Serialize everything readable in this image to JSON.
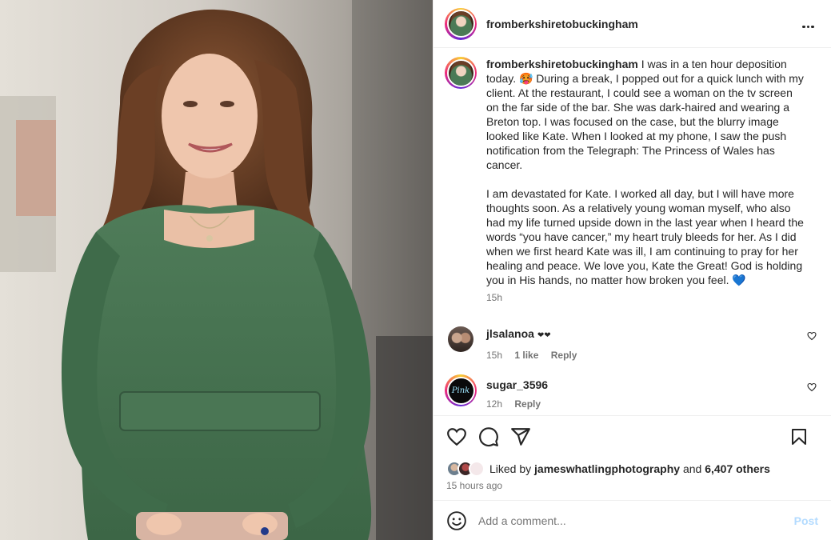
{
  "post": {
    "username": "fromberkshiretobuckingham",
    "caption_para1": "I was in a ten hour deposition today. 🥵 During a break, I popped out for a quick lunch with my client. At the restaurant, I could see a woman on the tv screen on the far side of the bar. She was dark-haired and wearing a Breton top. I was focused on the case, but the blurry image looked like Kate. When I looked at my phone, I saw the push notification from the Telegraph: The Princess of Wales has cancer.",
    "caption_para2": "I am devastated for Kate. I worked all day, but I will have more thoughts soon. As a relatively young woman myself, who also had my life turned upside down in the last year when I heard the words “you have cancer,” my heart truly bleeds for her. As I did when we first heard Kate was ill, I am continuing to pray for her healing and peace. We love you, Kate the Great! God is holding you in His hands, no matter how broken you feel. 💙",
    "caption_time": "15h",
    "more_icon": "more-horizontal-icon"
  },
  "comments": [
    {
      "username": "jlsalanoa",
      "text": "❤❤",
      "time": "15h",
      "likes": "1 like",
      "reply": "Reply"
    },
    {
      "username": "sugar_3596",
      "text": "",
      "time": "12h",
      "reply": "Reply",
      "avatar_text": "Pink"
    }
  ],
  "actions": {
    "icons": [
      "heart-icon",
      "comment-icon",
      "share-icon",
      "bookmark-icon"
    ]
  },
  "likes": {
    "prefix": "Liked by",
    "user": "jameswhatlingphotography",
    "and": "and",
    "count": "6,407 others"
  },
  "date": "15 hours ago",
  "add_comment": {
    "placeholder": "Add a comment...",
    "post_label": "Post"
  },
  "colors": {
    "post_disabled": "#b3dbff",
    "meta_gray": "#737373",
    "text": "#262626"
  }
}
